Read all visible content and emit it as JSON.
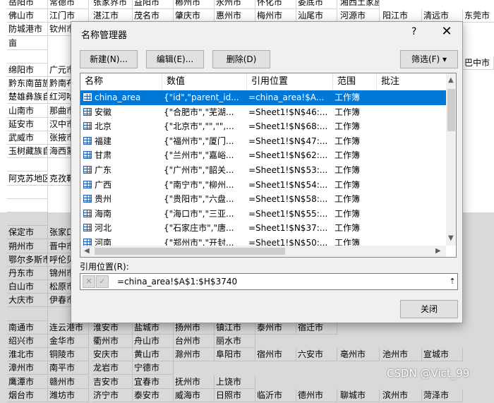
{
  "sheet": {
    "rows": [
      [
        "岳阳市",
        "常德市",
        "张家界市",
        "益阳市",
        "郴州市",
        "永州市",
        "怀化市",
        "娄底市",
        "湘西土家族"
      ],
      [
        "佛山市",
        "江门市",
        "湛江市",
        "茂名市",
        "肇庆市",
        "惠州市",
        "梅州市",
        "汕尾市",
        "河源市",
        "阳江市",
        "清远市",
        "东莞市"
      ],
      [
        "防城港市",
        "钦州市"
      ],
      [
        "亩"
      ],
      [
        ""
      ],
      [
        "绵阳市",
        "广元市"
      ],
      [
        "黔东南苗族",
        "黔南布"
      ],
      [
        "楚雄彝族自",
        "红河哈"
      ],
      [
        "山南市",
        "那曲市"
      ],
      [
        "延安市",
        "汉中市"
      ],
      [
        "武威市",
        "张掖市"
      ],
      [
        "玉树藏族自",
        "海西蒙"
      ],
      [
        ""
      ],
      [
        "阿克苏地区",
        "克孜勒"
      ],
      [
        ""
      ],
      [
        ""
      ],
      [
        ""
      ],
      [
        "保定市",
        "张家口"
      ],
      [
        "朔州市",
        "晋中市"
      ],
      [
        "鄂尔多斯市",
        "呼伦贝"
      ],
      [
        "丹东市",
        "锦州市"
      ],
      [
        "白山市",
        "松原市"
      ],
      [
        "大庆市",
        "伊春市"
      ],
      [
        ""
      ],
      [
        "南通市",
        "连云港市",
        "淮安市",
        "盐城市",
        "扬州市",
        "镇江市",
        "泰州市",
        "宿迁市"
      ],
      [
        "绍兴市",
        "金华市",
        "衢州市",
        "舟山市",
        "台州市",
        "丽水市"
      ],
      [
        "淮北市",
        "铜陵市",
        "安庆市",
        "黄山市",
        "滁州市",
        "阜阳市",
        "宿州市",
        "六安市",
        "亳州市",
        "池州市",
        "宣城市"
      ],
      [
        "漳州市",
        "南平市",
        "龙岩市",
        "宁德市"
      ],
      [
        "鹰潭市",
        "赣州市",
        "吉安市",
        "宜春市",
        "抚州市",
        "上饶市"
      ],
      [
        "烟台市",
        "潍坊市",
        "济宁市",
        "泰安市",
        "威海市",
        "日照市",
        "临沂市",
        "德州市",
        "聊城市",
        "滨州市",
        "菏泽市"
      ]
    ],
    "far_right_label": "巴中市"
  },
  "dialog": {
    "title": "名称管理器",
    "help": "?",
    "close": "✕",
    "buttons": {
      "new": "新建(N)...",
      "edit": "编辑(E)...",
      "delete": "删除(D)",
      "filter": "筛选(F) ▾"
    },
    "columns": [
      "名称",
      "数值",
      "引用位置",
      "范围",
      "批注"
    ],
    "items": [
      {
        "name": "china_area",
        "value": "{\"id\",\"parent_id...",
        "ref": "=china_area!$A...",
        "scope": "工作簿",
        "selected": true
      },
      {
        "name": "安徽",
        "value": "{\"合肥市\",\"芜湖...",
        "ref": "=Sheet1!$N$46:...",
        "scope": "工作簿"
      },
      {
        "name": "北京",
        "value": "{\"北京市\",\"\",\"\",...",
        "ref": "=Sheet1!$N$68:...",
        "scope": "工作簿"
      },
      {
        "name": "福建",
        "value": "{\"福州市\",\"厦门...",
        "ref": "=Sheet1!$N$47:...",
        "scope": "工作簿"
      },
      {
        "name": "甘肃",
        "value": "{\"兰州市\",\"嘉峪...",
        "ref": "=Sheet1!$N$62:...",
        "scope": "工作簿"
      },
      {
        "name": "广东",
        "value": "{\"广州市\",\"韶关...",
        "ref": "=Sheet1!$N$53:...",
        "scope": "工作簿"
      },
      {
        "name": "广西",
        "value": "{\"南宁市\",\"柳州...",
        "ref": "=Sheet1!$N$54:...",
        "scope": "工作簿"
      },
      {
        "name": "贵州",
        "value": "{\"贵阳市\",\"六盘...",
        "ref": "=Sheet1!$N$58:...",
        "scope": "工作簿"
      },
      {
        "name": "海南",
        "value": "{\"海口市\",\"三亚...",
        "ref": "=Sheet1!$N$55:...",
        "scope": "工作簿"
      },
      {
        "name": "河北",
        "value": "{\"石家庄市\",\"唐...",
        "ref": "=Sheet1!$N$37:...",
        "scope": "工作簿"
      },
      {
        "name": "河南",
        "value": "{\"郑州市\",\"开封...",
        "ref": "=Sheet1!$N$50:...",
        "scope": "工作簿"
      }
    ],
    "ref_label": "引用位置(R):",
    "ref_value": "=china_area!$A$1:$H$3740",
    "ref_cancel": "✕",
    "ref_confirm": "✓",
    "collapse": "⇡",
    "close_button": "关闭"
  },
  "watermark": "CSDN @Vict_99"
}
